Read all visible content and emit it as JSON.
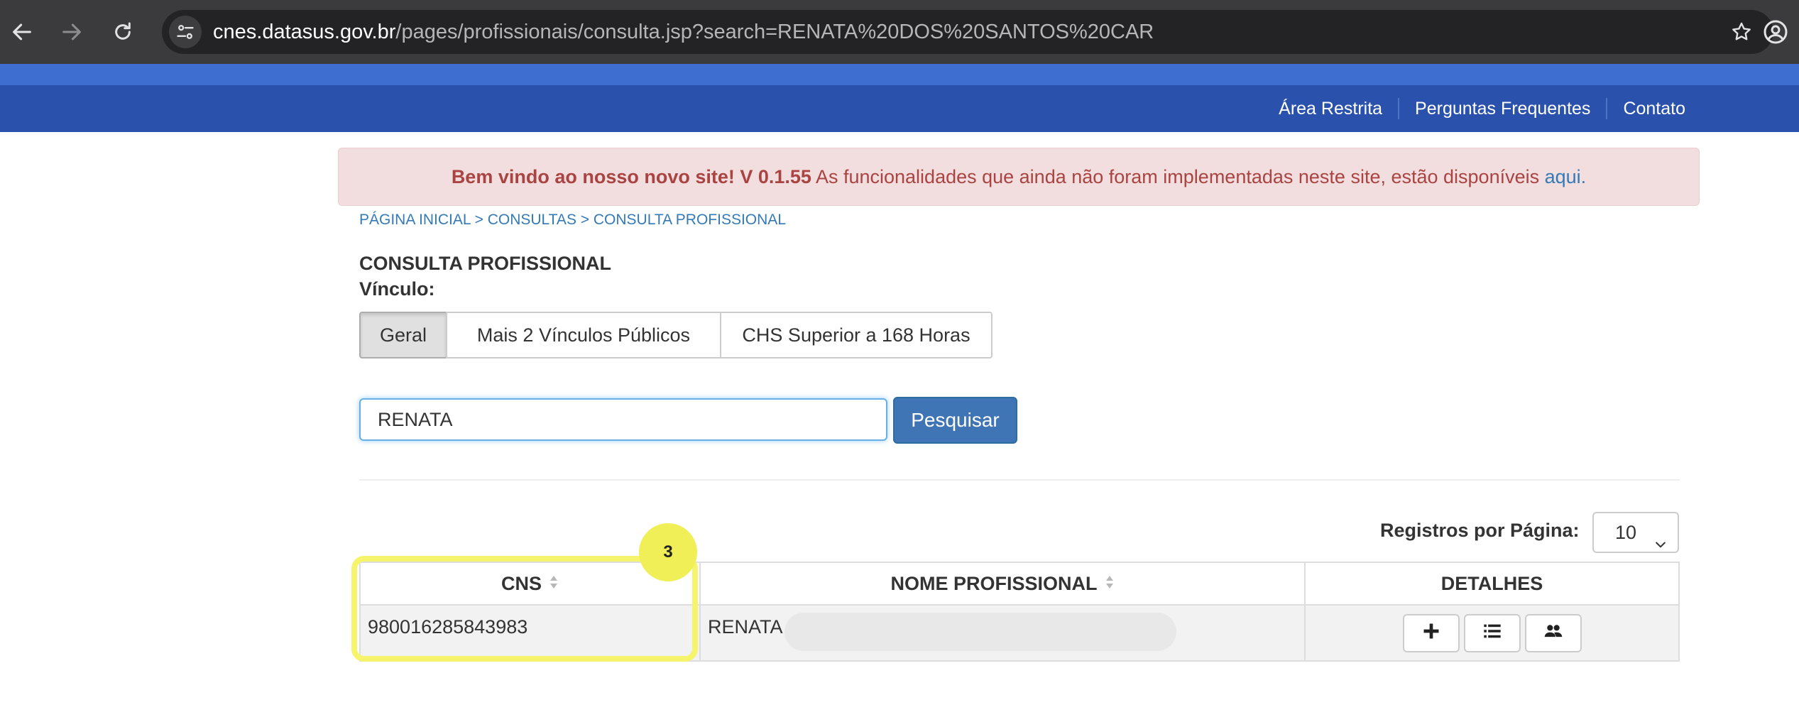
{
  "browser": {
    "url_domain": "cnes.datasus.gov.br",
    "url_path": "/pages/profissionais/consulta.jsp?search=RENATA%20DOS%20SANTOS%20CAR",
    "icons": [
      "back-icon",
      "forward-icon",
      "reload-icon",
      "site-info-icon",
      "bookmark-star-icon",
      "profile-icon"
    ]
  },
  "navbar": {
    "links": [
      "Área Restrita",
      "Perguntas Frequentes",
      "Contato"
    ]
  },
  "alert": {
    "bold_text": "Bem vindo ao nosso novo site! V 0.1.55",
    "text": " As funcionalidades que ainda não foram implementadas neste site, estão disponíveis ",
    "link_text": "aqui."
  },
  "breadcrumb": "PÁGINA INICIAL > CONSULTAS > CONSULTA PROFISSIONAL",
  "page": {
    "title": "CONSULTA PROFISSIONAL",
    "vinculo_label": "Vínculo:",
    "tabs": [
      {
        "label": "Geral",
        "active": true
      },
      {
        "label": "Mais 2 Vínculos Públicos",
        "active": false
      },
      {
        "label": "CHS Superior a 168 Horas",
        "active": false
      }
    ],
    "search_value": "RENATA",
    "search_button": "Pesquisar",
    "records_per_page_label": "Registros por Página:",
    "records_per_page_value": "10"
  },
  "table": {
    "headers": [
      "CNS",
      "NOME PROFISSIONAL",
      "DETALHES"
    ],
    "rows": [
      {
        "cns": "980016285843983",
        "nome": "RENATA",
        "detail_icons": [
          "plus-icon",
          "list-icon",
          "users-icon"
        ]
      }
    ]
  },
  "annotation": {
    "badge_number": "3",
    "color": "#f6f46a"
  }
}
